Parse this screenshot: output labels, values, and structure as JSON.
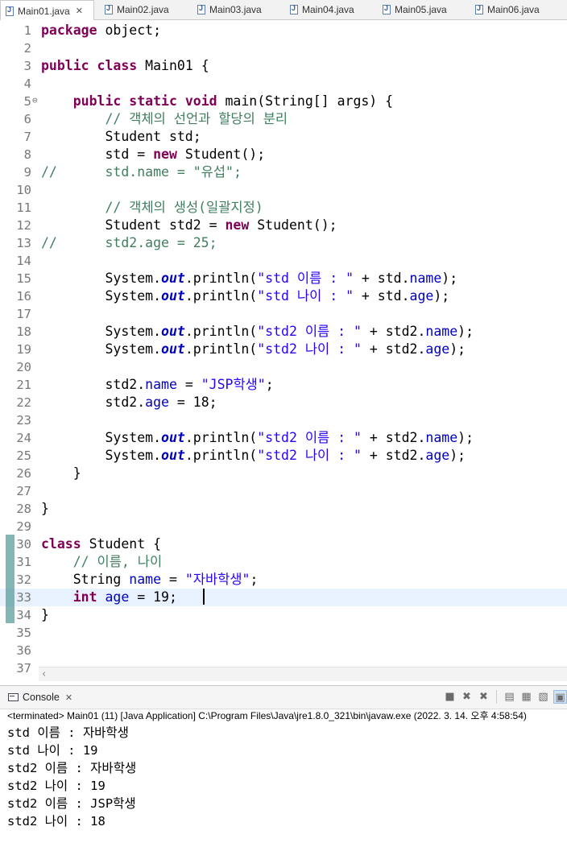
{
  "tabs": [
    {
      "label": "Main01.java",
      "active": true
    },
    {
      "label": "Main02.java",
      "active": false
    },
    {
      "label": "Main03.java",
      "active": false
    },
    {
      "label": "Main04.java",
      "active": false
    },
    {
      "label": "Main05.java",
      "active": false
    },
    {
      "label": "Main06.java",
      "active": false
    }
  ],
  "editor": {
    "lines": [
      {
        "n": "1",
        "tokens": [
          [
            "kw",
            "package"
          ],
          [
            "",
            "object;"
          ]
        ]
      },
      {
        "n": "2",
        "tokens": []
      },
      {
        "n": "3",
        "tokens": [
          [
            "kw",
            "public class"
          ],
          [
            "",
            "Main01 {"
          ]
        ]
      },
      {
        "n": "4",
        "tokens": []
      },
      {
        "n": "5",
        "fold": "⊖",
        "tokens": [
          [
            "",
            "    "
          ],
          [
            "kw",
            "public static void"
          ],
          [
            "",
            "main(String[] args) {"
          ]
        ]
      },
      {
        "n": "6",
        "tokens": [
          [
            "",
            "        "
          ],
          [
            "cm",
            "// 객체의 선언과 할당의 분리"
          ]
        ]
      },
      {
        "n": "7",
        "tokens": [
          [
            "",
            "        Student std;"
          ]
        ]
      },
      {
        "n": "8",
        "tokens": [
          [
            "",
            "        std = "
          ],
          [
            "kw",
            "new"
          ],
          [
            "",
            " Student();"
          ]
        ]
      },
      {
        "n": "9",
        "tokens": [
          [
            "cm",
            "//      std.name = \"유섭\";"
          ]
        ]
      },
      {
        "n": "10",
        "tokens": []
      },
      {
        "n": "11",
        "tokens": [
          [
            "",
            "        "
          ],
          [
            "cm",
            "// 객체의 생성(일괄지정)"
          ]
        ]
      },
      {
        "n": "12",
        "tokens": [
          [
            "",
            "        Student std2 = "
          ],
          [
            "kw",
            "new"
          ],
          [
            "",
            " Student();"
          ]
        ]
      },
      {
        "n": "13",
        "tokens": [
          [
            "cm",
            "//      std2.age = 25;"
          ]
        ]
      },
      {
        "n": "14",
        "tokens": []
      },
      {
        "n": "15",
        "tokens": [
          [
            "",
            "        System."
          ],
          [
            "sf",
            "out"
          ],
          [
            "",
            ".println("
          ],
          [
            "st",
            "\"std 이름 : \""
          ],
          [
            "",
            " + std."
          ],
          [
            "fd",
            "name"
          ],
          [
            "",
            ");"
          ]
        ]
      },
      {
        "n": "16",
        "tokens": [
          [
            "",
            "        System."
          ],
          [
            "sf",
            "out"
          ],
          [
            "",
            ".println("
          ],
          [
            "st",
            "\"std 나이 : \""
          ],
          [
            "",
            " + std."
          ],
          [
            "fd",
            "age"
          ],
          [
            "",
            ");"
          ]
        ]
      },
      {
        "n": "17",
        "tokens": []
      },
      {
        "n": "18",
        "tokens": [
          [
            "",
            "        System."
          ],
          [
            "sf",
            "out"
          ],
          [
            "",
            ".println("
          ],
          [
            "st",
            "\"std2 이름 : \""
          ],
          [
            "",
            " + std2."
          ],
          [
            "fd",
            "name"
          ],
          [
            "",
            ");"
          ]
        ]
      },
      {
        "n": "19",
        "tokens": [
          [
            "",
            "        System."
          ],
          [
            "sf",
            "out"
          ],
          [
            "",
            ".println("
          ],
          [
            "st",
            "\"std2 나이 : \""
          ],
          [
            "",
            " + std2."
          ],
          [
            "fd",
            "age"
          ],
          [
            "",
            ");"
          ]
        ]
      },
      {
        "n": "20",
        "tokens": []
      },
      {
        "n": "21",
        "tokens": [
          [
            "",
            "        std2."
          ],
          [
            "fd",
            "name"
          ],
          [
            "",
            " = "
          ],
          [
            "st",
            "\"JSP학생\""
          ],
          [
            "",
            ";"
          ]
        ]
      },
      {
        "n": "22",
        "tokens": [
          [
            "",
            "        std2."
          ],
          [
            "fd",
            "age"
          ],
          [
            "",
            " = 18;"
          ]
        ]
      },
      {
        "n": "23",
        "tokens": []
      },
      {
        "n": "24",
        "tokens": [
          [
            "",
            "        System."
          ],
          [
            "sf",
            "out"
          ],
          [
            "",
            ".println("
          ],
          [
            "st",
            "\"std2 이름 : \""
          ],
          [
            "",
            " + std2."
          ],
          [
            "fd",
            "name"
          ],
          [
            "",
            ");"
          ]
        ]
      },
      {
        "n": "25",
        "tokens": [
          [
            "",
            "        System."
          ],
          [
            "sf",
            "out"
          ],
          [
            "",
            ".println("
          ],
          [
            "st",
            "\"std2 나이 : \""
          ],
          [
            "",
            " + std2."
          ],
          [
            "fd",
            "age"
          ],
          [
            "",
            ");"
          ]
        ]
      },
      {
        "n": "26",
        "tokens": [
          [
            "",
            "    }"
          ]
        ]
      },
      {
        "n": "27",
        "tokens": []
      },
      {
        "n": "28",
        "tokens": [
          [
            "",
            "}"
          ]
        ]
      },
      {
        "n": "29",
        "tokens": []
      },
      {
        "n": "30",
        "tokens": [
          [
            "kw",
            "class"
          ],
          [
            "",
            " Student {"
          ]
        ]
      },
      {
        "n": "31",
        "tokens": [
          [
            "",
            "    "
          ],
          [
            "cm",
            "// 이름, 나이"
          ]
        ]
      },
      {
        "n": "32",
        "tokens": [
          [
            "",
            "    String "
          ],
          [
            "fd",
            "name"
          ],
          [
            "",
            " = "
          ],
          [
            "st",
            "\"자바학생\""
          ],
          [
            "",
            ";"
          ]
        ]
      },
      {
        "n": "33",
        "current": true,
        "tokens": [
          [
            "",
            "    "
          ],
          [
            "kw",
            "int"
          ],
          [
            "",
            " "
          ],
          [
            "fd",
            "age"
          ],
          [
            "",
            " = 19;"
          ]
        ]
      },
      {
        "n": "34",
        "tokens": [
          [
            "",
            "}"
          ]
        ]
      },
      {
        "n": "35",
        "tokens": []
      },
      {
        "n": "36",
        "tokens": []
      },
      {
        "n": "37",
        "tokens": []
      }
    ]
  },
  "console": {
    "tab_label": "Console",
    "status": "<terminated> Main01 (11) [Java Application] C:\\Program Files\\Java\\jre1.8.0_321\\bin\\javaw.exe (2022. 3. 14. 오후 4:58:54)",
    "output": [
      "std 이름 : 자바학생",
      "std 나이 : 19",
      "std2 이름 : 자바학생",
      "std2 나이 : 19",
      "std2 이름 : JSP학생",
      "std2 나이 : 18"
    ]
  }
}
